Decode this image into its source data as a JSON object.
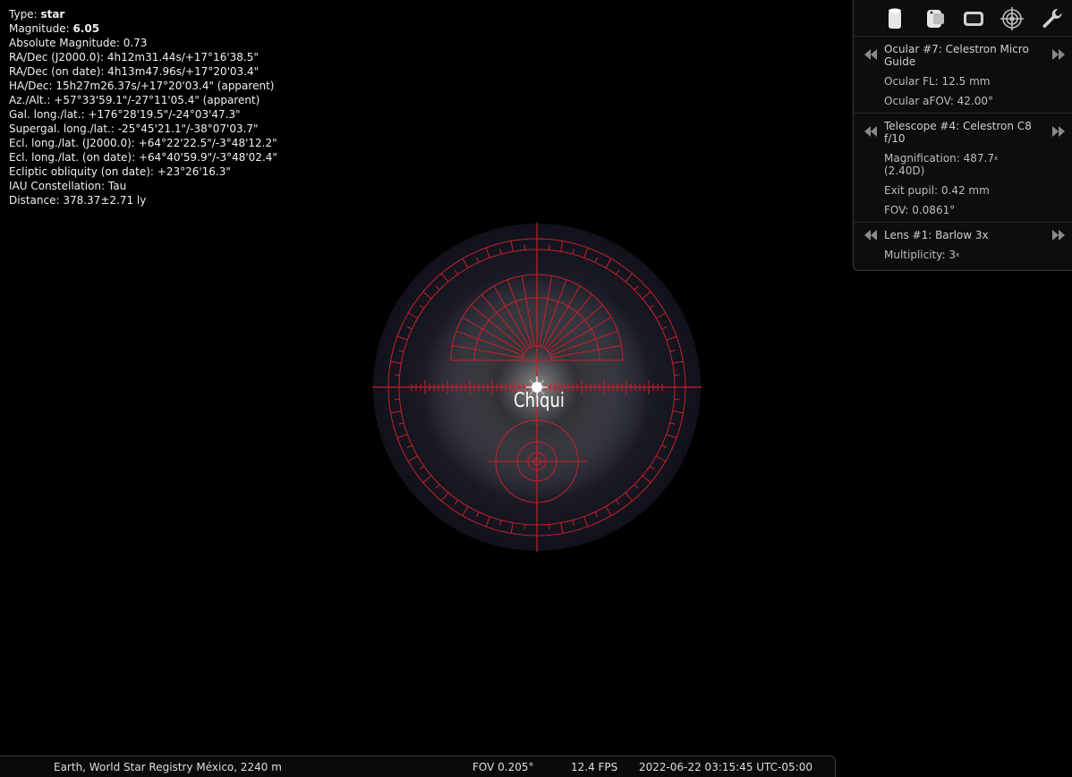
{
  "object_info": {
    "type_label": "Type:",
    "type_value": "star",
    "magnitude_label": "Magnitude:",
    "magnitude_value": "6.05",
    "lines": [
      "Absolute Magnitude: 0.73",
      "RA/Dec (J2000.0): 4h12m31.44s/+17°16'38.5\"",
      "RA/Dec (on date): 4h13m47.96s/+17°20'03.4\"",
      "HA/Dec: 15h27m26.37s/+17°20'03.4\" (apparent)",
      "Az./Alt.: +57°33'59.1\"/-27°11'05.4\" (apparent)",
      "Gal. long./lat.: +176°28'19.5\"/-24°03'47.3\"",
      "Supergal. long./lat.: -25°45'21.1\"/-38°07'03.7\"",
      "Ecl. long./lat. (J2000.0): +64°22'22.5\"/-3°48'12.2\"",
      "Ecl. long./lat. (on date): +64°40'59.9\"/-3°48'02.4\"",
      "Ecliptic obliquity (on date): +23°26'16.3\"",
      "IAU Constellation: Tau",
      "Distance: 378.37±2.71 ly"
    ]
  },
  "star_label": "Chiqui",
  "ocular_panel": {
    "toolbar_icons": [
      "ocular-view-icon",
      "sensor-frame-icon",
      "crosshair-icon",
      "rings-icon",
      "wrench-icon"
    ],
    "ocular": {
      "name": "Ocular #7: Celestron Micro Guide",
      "fl": "Ocular FL: 12.5 mm",
      "afov": "Ocular aFOV: 42.00°"
    },
    "telescope": {
      "name": "Telescope #4: Celestron C8 f/10",
      "magnification": "Magnification: 487.7",
      "magnification_suffix": "x",
      "magnification_d": "(2.40D)",
      "exit_pupil": "Exit pupil: 0.42 mm",
      "fov": "FOV: 0.0861°"
    },
    "lens": {
      "name": "Lens #1: Barlow 3x",
      "multiplicity": "Multiplicity: 3",
      "multiplicity_suffix": "x"
    }
  },
  "statusbar": {
    "location": "Earth, World Star Registry México, 2240 m",
    "fov": "FOV 0.205°",
    "fps": "12.4 FPS",
    "datetime": "2022-06-22 03:15:45 UTC-05:00"
  },
  "colors": {
    "reticle": "#c8202a",
    "panel_bg": "#0d0d0d"
  }
}
